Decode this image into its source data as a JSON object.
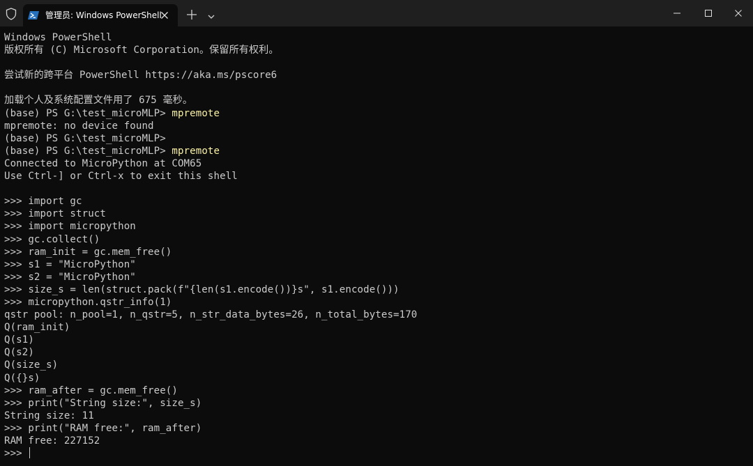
{
  "window": {
    "tab_title": "管理员: Windows PowerShell",
    "icons": {
      "shield": "shield-icon",
      "tab": "powershell-icon",
      "tab_close": "close-icon",
      "new_tab": "plus-icon",
      "dropdown": "chevron-down-icon",
      "minimize": "minimize-icon",
      "maximize": "maximize-icon",
      "close": "close-icon"
    }
  },
  "colors": {
    "background": "#0c0c0c",
    "titlebar": "#1f1f1f",
    "text": "#cccccc",
    "command": "#f9f1a5"
  },
  "terminal": {
    "l01": "Windows PowerShell",
    "l02": "版权所有 (C) Microsoft Corporation。保留所有权利。",
    "l03": "",
    "l04": "尝试新的跨平台 PowerShell https://aka.ms/pscore6",
    "l05": "",
    "l06": "加载个人及系统配置文件用了 675 毫秒。",
    "l07_prompt": "(base) PS G:\\test_microMLP> ",
    "l07_cmd": "mpremote",
    "l08": "mpremote: no device found",
    "l09_prompt": "(base) PS G:\\test_microMLP>",
    "l10_prompt": "(base) PS G:\\test_microMLP> ",
    "l10_cmd": "mpremote",
    "l11": "Connected to MicroPython at COM65",
    "l12": "Use Ctrl-] or Ctrl-x to exit this shell",
    "l13": "",
    "l14": ">>> import gc",
    "l15": ">>> import struct",
    "l16": ">>> import micropython",
    "l17": ">>> gc.collect()",
    "l18": ">>> ram_init = gc.mem_free()",
    "l19": ">>> s1 = \"MicroPython\"",
    "l20": ">>> s2 = \"MicroPython\"",
    "l21": ">>> size_s = len(struct.pack(f\"{len(s1.encode())}s\", s1.encode()))",
    "l22": ">>> micropython.qstr_info(1)",
    "l23": "qstr pool: n_pool=1, n_qstr=5, n_str_data_bytes=26, n_total_bytes=170",
    "l24": "Q(ram_init)",
    "l25": "Q(s1)",
    "l26": "Q(s2)",
    "l27": "Q(size_s)",
    "l28": "Q({}s)",
    "l29": ">>> ram_after = gc.mem_free()",
    "l30": ">>> print(\"String size:\", size_s)",
    "l31": "String size: 11",
    "l32": ">>> print(\"RAM free:\", ram_after)",
    "l33": "RAM free: 227152",
    "l34_prompt": ">>> "
  }
}
